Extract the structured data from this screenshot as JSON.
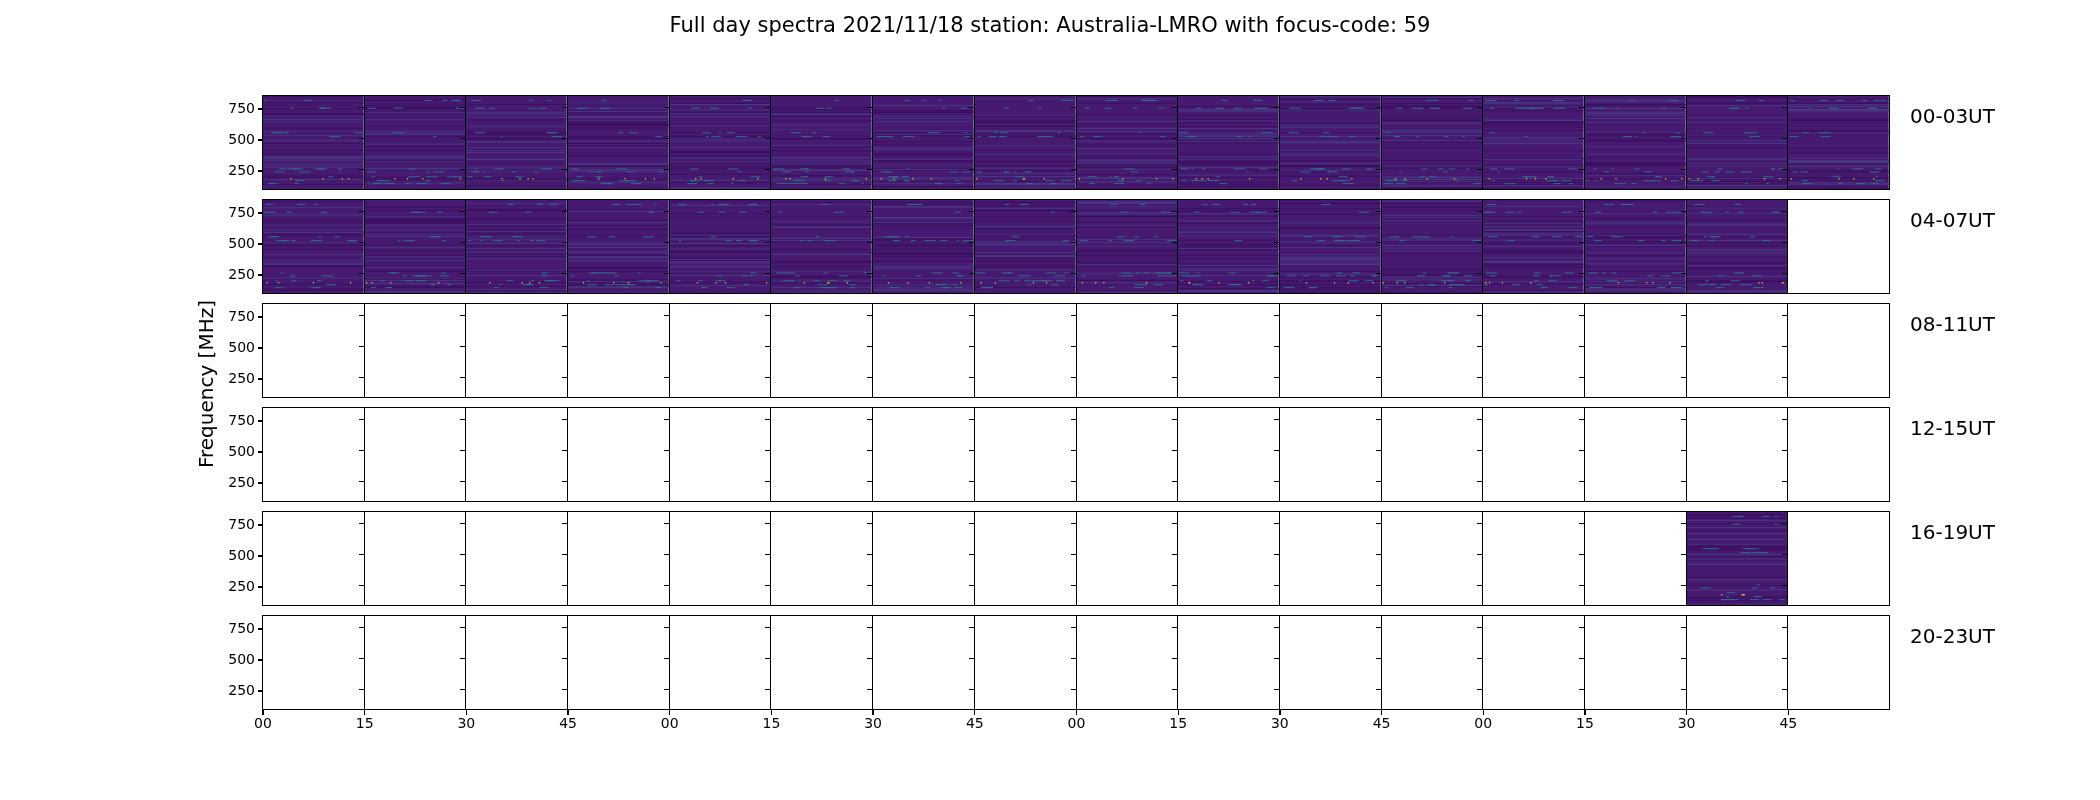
{
  "title": "Full day spectra 2021/11/18 station: Australia-LMRO with focus-code: 59",
  "ylabel": "Frequency [MHz]",
  "rows": [
    {
      "label": "00-03UT",
      "yticks": [
        "750",
        "500",
        "250"
      ],
      "panels": [
        {
          "has_data": true
        },
        {
          "has_data": true
        },
        {
          "has_data": true
        },
        {
          "has_data": true
        },
        {
          "has_data": true
        },
        {
          "has_data": true
        },
        {
          "has_data": true
        },
        {
          "has_data": true
        },
        {
          "has_data": true
        },
        {
          "has_data": true
        },
        {
          "has_data": true
        },
        {
          "has_data": true
        },
        {
          "has_data": true
        },
        {
          "has_data": true
        },
        {
          "has_data": true
        },
        {
          "has_data": true
        }
      ]
    },
    {
      "label": "04-07UT",
      "yticks": [
        "750",
        "500",
        "250"
      ],
      "panels": [
        {
          "has_data": true
        },
        {
          "has_data": true
        },
        {
          "has_data": true
        },
        {
          "has_data": true
        },
        {
          "has_data": true
        },
        {
          "has_data": true
        },
        {
          "has_data": true
        },
        {
          "has_data": true
        },
        {
          "has_data": true
        },
        {
          "has_data": true
        },
        {
          "has_data": true
        },
        {
          "has_data": true
        },
        {
          "has_data": true
        },
        {
          "has_data": true
        },
        {
          "has_data": true
        },
        {
          "has_data": false
        }
      ]
    },
    {
      "label": "08-11UT",
      "yticks": [
        "750",
        "500",
        "250"
      ],
      "panels": [
        {
          "has_data": false
        },
        {
          "has_data": false
        },
        {
          "has_data": false
        },
        {
          "has_data": false
        },
        {
          "has_data": false
        },
        {
          "has_data": false
        },
        {
          "has_data": false
        },
        {
          "has_data": false
        },
        {
          "has_data": false
        },
        {
          "has_data": false
        },
        {
          "has_data": false
        },
        {
          "has_data": false
        },
        {
          "has_data": false
        },
        {
          "has_data": false
        },
        {
          "has_data": false
        },
        {
          "has_data": false
        }
      ]
    },
    {
      "label": "12-15UT",
      "yticks": [
        "750",
        "500",
        "250"
      ],
      "panels": [
        {
          "has_data": false
        },
        {
          "has_data": false
        },
        {
          "has_data": false
        },
        {
          "has_data": false
        },
        {
          "has_data": false
        },
        {
          "has_data": false
        },
        {
          "has_data": false
        },
        {
          "has_data": false
        },
        {
          "has_data": false
        },
        {
          "has_data": false
        },
        {
          "has_data": false
        },
        {
          "has_data": false
        },
        {
          "has_data": false
        },
        {
          "has_data": false
        },
        {
          "has_data": false
        },
        {
          "has_data": false
        }
      ]
    },
    {
      "label": "16-19UT",
      "yticks": [
        "750",
        "500",
        "250"
      ],
      "panels": [
        {
          "has_data": false
        },
        {
          "has_data": false
        },
        {
          "has_data": false
        },
        {
          "has_data": false
        },
        {
          "has_data": false
        },
        {
          "has_data": false
        },
        {
          "has_data": false
        },
        {
          "has_data": false
        },
        {
          "has_data": false
        },
        {
          "has_data": false
        },
        {
          "has_data": false
        },
        {
          "has_data": false
        },
        {
          "has_data": false
        },
        {
          "has_data": false
        },
        {
          "has_data": true
        },
        {
          "has_data": false
        }
      ]
    },
    {
      "label": "20-23UT",
      "yticks": [
        "750",
        "500",
        "250"
      ],
      "panels": [
        {
          "has_data": false
        },
        {
          "has_data": false
        },
        {
          "has_data": false
        },
        {
          "has_data": false
        },
        {
          "has_data": false
        },
        {
          "has_data": false
        },
        {
          "has_data": false
        },
        {
          "has_data": false
        },
        {
          "has_data": false
        },
        {
          "has_data": false
        },
        {
          "has_data": false
        },
        {
          "has_data": false
        },
        {
          "has_data": false
        },
        {
          "has_data": false
        },
        {
          "has_data": false
        },
        {
          "has_data": false
        }
      ]
    }
  ],
  "xticks": [
    "00",
    "15",
    "30",
    "45",
    "00",
    "15",
    "30",
    "45",
    "00",
    "15",
    "30",
    "45",
    "00",
    "15",
    "30",
    "45"
  ]
}
